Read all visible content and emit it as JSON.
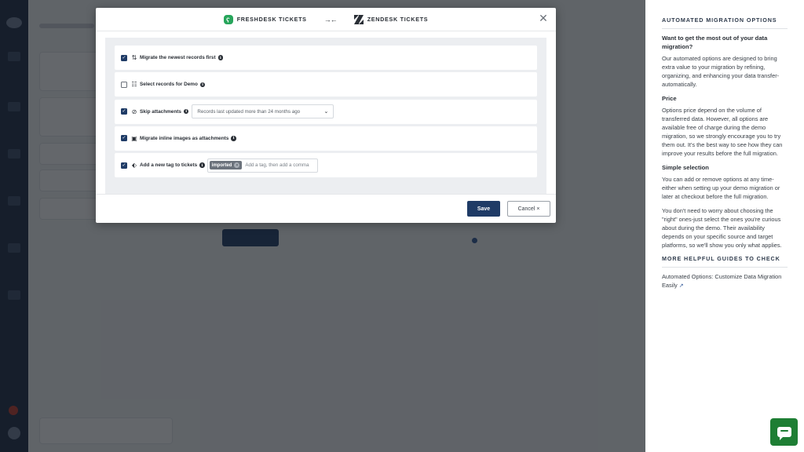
{
  "modal": {
    "source_brand": "FRESHDESK TICKETS",
    "target_brand": "ZENDESK TICKETS",
    "close_label": "✕",
    "options": [
      {
        "label": "Migrate the newest records first",
        "checked": true,
        "icon": "sort-arrows-icon"
      },
      {
        "label": "Select records for Demo",
        "checked": false,
        "icon": "records-list-icon"
      },
      {
        "label": "Skip attachments",
        "checked": true,
        "icon": "attachment-off-icon",
        "select_value": "Records last updated more than 24 months ago"
      },
      {
        "label": "Migrate inline images as attachments",
        "checked": true,
        "icon": "image-icon"
      },
      {
        "label": "Add a new tag to tickets",
        "checked": true,
        "icon": "tag-icon",
        "tag": "imported",
        "tag_placeholder": "Add a tag, then add a comma"
      }
    ],
    "save_label": "Save",
    "cancel_label": "Cancel ×"
  },
  "help_panel": {
    "title": "AUTOMATED MIGRATION OPTIONS",
    "intro_heading": "Want to get the most out of your data migration?",
    "intro_text": "Our automated options are designed to bring extra value to your migration by refining, organizing, and enhancing your data transfer-automatically.",
    "price_heading": "Price",
    "price_text": "Options price depend on the volume of transferred data. However, all options are available free of charge during the demo migration, so we strongly encourage you to try them out. It's the best way to see how they can improve your results before the full migration.",
    "selection_heading": "Simple selection",
    "selection_text_1": "You can add or remove options at any time-either when setting up your demo migration or later at checkout before the full migration.",
    "selection_text_2": "You don't need to worry about choosing the \"right\" ones-just select the ones you're curious about during the demo. Their availability depends on your specific source and target platforms, so we'll show you only what applies.",
    "guides_title": "MORE HELPFUL GUIDES TO CHECK",
    "guide_link": "Automated Options: Customize Data Migration Easily"
  },
  "colors": {
    "primary": "#1f3b66",
    "freshdesk": "#27a55b",
    "chat": "#1e7e34"
  }
}
